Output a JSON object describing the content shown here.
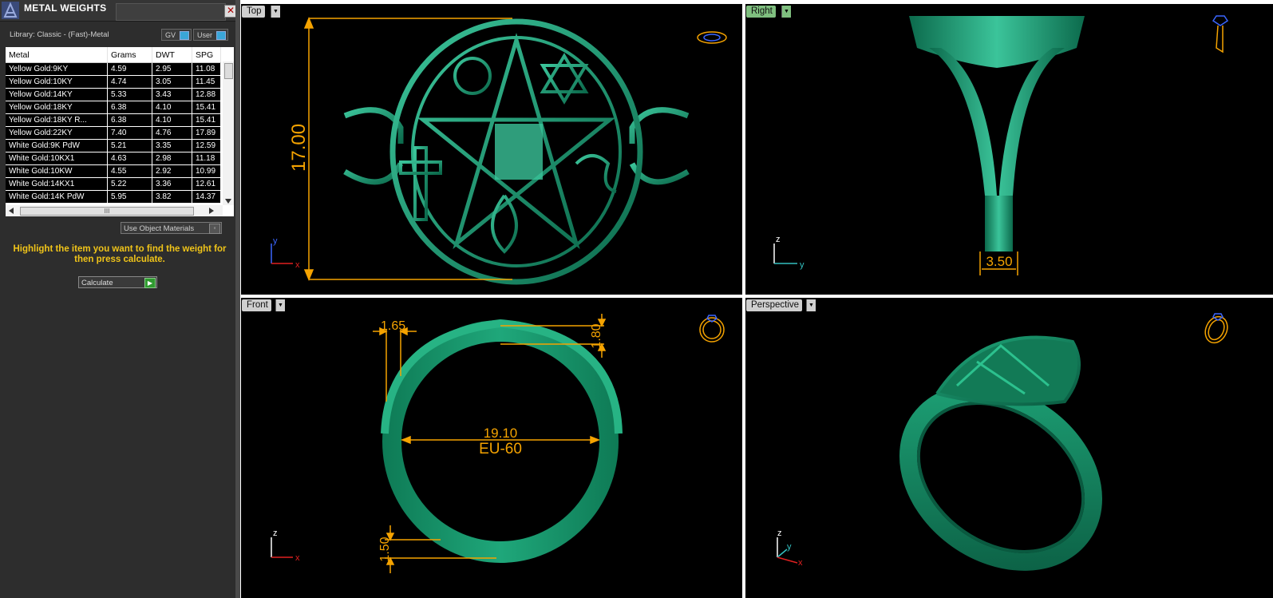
{
  "panel": {
    "title": "METAL WEIGHTS",
    "library_label": "Library: Classic - (Fast)-Metal",
    "toggle_gv": "GV",
    "toggle_user": "User",
    "use_object_materials": "Use Object Materials",
    "help_text": "Highlight the item you want to find the weight for then press calculate.",
    "calculate_label": "Calculate",
    "close_glyph": "✕",
    "hscroll_grip": "III"
  },
  "table": {
    "headers": [
      "Metal",
      "Grams",
      "DWT",
      "SPG"
    ],
    "rows": [
      [
        "Yellow Gold:9KY",
        "4.59",
        "2.95",
        "11.08"
      ],
      [
        "Yellow Gold:10KY",
        "4.74",
        "3.05",
        "11.45"
      ],
      [
        "Yellow Gold:14KY",
        "5.33",
        "3.43",
        "12.88"
      ],
      [
        "Yellow Gold:18KY",
        "6.38",
        "4.10",
        "15.41"
      ],
      [
        "Yellow Gold:18KY R...",
        "6.38",
        "4.10",
        "15.41"
      ],
      [
        "Yellow Gold:22KY",
        "7.40",
        "4.76",
        "17.89"
      ],
      [
        "White Gold:9K PdW",
        "5.21",
        "3.35",
        "12.59"
      ],
      [
        "White Gold:10KX1",
        "4.63",
        "2.98",
        "11.18"
      ],
      [
        "White Gold:10KW",
        "4.55",
        "2.92",
        "10.99"
      ],
      [
        "White Gold:14KX1",
        "5.22",
        "3.36",
        "12.61"
      ],
      [
        "White Gold:14K PdW",
        "5.95",
        "3.82",
        "14.37"
      ]
    ]
  },
  "viewports": {
    "top": {
      "label": "Top",
      "dim_height": "17.00",
      "axis_y": "y",
      "axis_x": "x"
    },
    "right": {
      "label": "Right",
      "dim_width": "3.50",
      "axis_z": "z",
      "axis_y": "y"
    },
    "front": {
      "label": "Front",
      "dim_top_width": "1.65",
      "dim_top_height": "1.80",
      "dim_diameter": "19.10",
      "ring_size": "EU-60",
      "dim_bottom": "1.50",
      "axis_z": "z",
      "axis_x": "x"
    },
    "perspective": {
      "label": "Perspective",
      "axis_z": "z",
      "axis_y": "y",
      "axis_x": "x"
    }
  },
  "colors": {
    "ring_green": "#1f8f6a",
    "dimension_orange": "#f5a300",
    "active_label_green": "#7fbf7f",
    "viewport_bg": "#000000"
  }
}
